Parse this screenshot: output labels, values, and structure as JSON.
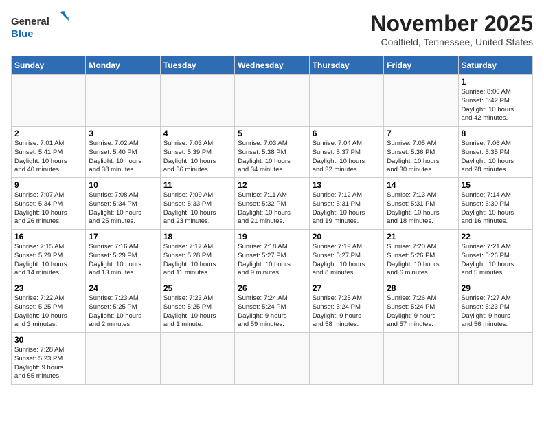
{
  "logo": {
    "line1": "General",
    "line2": "Blue"
  },
  "title": "November 2025",
  "location": "Coalfield, Tennessee, United States",
  "weekdays": [
    "Sunday",
    "Monday",
    "Tuesday",
    "Wednesday",
    "Thursday",
    "Friday",
    "Saturday"
  ],
  "weeks": [
    [
      {
        "day": "",
        "info": ""
      },
      {
        "day": "",
        "info": ""
      },
      {
        "day": "",
        "info": ""
      },
      {
        "day": "",
        "info": ""
      },
      {
        "day": "",
        "info": ""
      },
      {
        "day": "",
        "info": ""
      },
      {
        "day": "1",
        "info": "Sunrise: 8:00 AM\nSunset: 6:42 PM\nDaylight: 10 hours\nand 42 minutes."
      }
    ],
    [
      {
        "day": "2",
        "info": "Sunrise: 7:01 AM\nSunset: 5:41 PM\nDaylight: 10 hours\nand 40 minutes."
      },
      {
        "day": "3",
        "info": "Sunrise: 7:02 AM\nSunset: 5:40 PM\nDaylight: 10 hours\nand 38 minutes."
      },
      {
        "day": "4",
        "info": "Sunrise: 7:03 AM\nSunset: 5:39 PM\nDaylight: 10 hours\nand 36 minutes."
      },
      {
        "day": "5",
        "info": "Sunrise: 7:03 AM\nSunset: 5:38 PM\nDaylight: 10 hours\nand 34 minutes."
      },
      {
        "day": "6",
        "info": "Sunrise: 7:04 AM\nSunset: 5:37 PM\nDaylight: 10 hours\nand 32 minutes."
      },
      {
        "day": "7",
        "info": "Sunrise: 7:05 AM\nSunset: 5:36 PM\nDaylight: 10 hours\nand 30 minutes."
      },
      {
        "day": "8",
        "info": "Sunrise: 7:06 AM\nSunset: 5:35 PM\nDaylight: 10 hours\nand 28 minutes."
      }
    ],
    [
      {
        "day": "9",
        "info": "Sunrise: 7:07 AM\nSunset: 5:34 PM\nDaylight: 10 hours\nand 26 minutes."
      },
      {
        "day": "10",
        "info": "Sunrise: 7:08 AM\nSunset: 5:34 PM\nDaylight: 10 hours\nand 25 minutes."
      },
      {
        "day": "11",
        "info": "Sunrise: 7:09 AM\nSunset: 5:33 PM\nDaylight: 10 hours\nand 23 minutes."
      },
      {
        "day": "12",
        "info": "Sunrise: 7:11 AM\nSunset: 5:32 PM\nDaylight: 10 hours\nand 21 minutes."
      },
      {
        "day": "13",
        "info": "Sunrise: 7:12 AM\nSunset: 5:31 PM\nDaylight: 10 hours\nand 19 minutes."
      },
      {
        "day": "14",
        "info": "Sunrise: 7:13 AM\nSunset: 5:31 PM\nDaylight: 10 hours\nand 18 minutes."
      },
      {
        "day": "15",
        "info": "Sunrise: 7:14 AM\nSunset: 5:30 PM\nDaylight: 10 hours\nand 16 minutes."
      }
    ],
    [
      {
        "day": "16",
        "info": "Sunrise: 7:15 AM\nSunset: 5:29 PM\nDaylight: 10 hours\nand 14 minutes."
      },
      {
        "day": "17",
        "info": "Sunrise: 7:16 AM\nSunset: 5:29 PM\nDaylight: 10 hours\nand 13 minutes."
      },
      {
        "day": "18",
        "info": "Sunrise: 7:17 AM\nSunset: 5:28 PM\nDaylight: 10 hours\nand 11 minutes."
      },
      {
        "day": "19",
        "info": "Sunrise: 7:18 AM\nSunset: 5:27 PM\nDaylight: 10 hours\nand 9 minutes."
      },
      {
        "day": "20",
        "info": "Sunrise: 7:19 AM\nSunset: 5:27 PM\nDaylight: 10 hours\nand 8 minutes."
      },
      {
        "day": "21",
        "info": "Sunrise: 7:20 AM\nSunset: 5:26 PM\nDaylight: 10 hours\nand 6 minutes."
      },
      {
        "day": "22",
        "info": "Sunrise: 7:21 AM\nSunset: 5:26 PM\nDaylight: 10 hours\nand 5 minutes."
      }
    ],
    [
      {
        "day": "23",
        "info": "Sunrise: 7:22 AM\nSunset: 5:25 PM\nDaylight: 10 hours\nand 3 minutes."
      },
      {
        "day": "24",
        "info": "Sunrise: 7:23 AM\nSunset: 5:25 PM\nDaylight: 10 hours\nand 2 minutes."
      },
      {
        "day": "25",
        "info": "Sunrise: 7:23 AM\nSunset: 5:25 PM\nDaylight: 10 hours\nand 1 minute."
      },
      {
        "day": "26",
        "info": "Sunrise: 7:24 AM\nSunset: 5:24 PM\nDaylight: 9 hours\nand 59 minutes."
      },
      {
        "day": "27",
        "info": "Sunrise: 7:25 AM\nSunset: 5:24 PM\nDaylight: 9 hours\nand 58 minutes."
      },
      {
        "day": "28",
        "info": "Sunrise: 7:26 AM\nSunset: 5:24 PM\nDaylight: 9 hours\nand 57 minutes."
      },
      {
        "day": "29",
        "info": "Sunrise: 7:27 AM\nSunset: 5:23 PM\nDaylight: 9 hours\nand 56 minutes."
      }
    ],
    [
      {
        "day": "30",
        "info": "Sunrise: 7:28 AM\nSunset: 5:23 PM\nDaylight: 9 hours\nand 55 minutes."
      },
      {
        "day": "",
        "info": ""
      },
      {
        "day": "",
        "info": ""
      },
      {
        "day": "",
        "info": ""
      },
      {
        "day": "",
        "info": ""
      },
      {
        "day": "",
        "info": ""
      },
      {
        "day": "",
        "info": ""
      }
    ]
  ]
}
